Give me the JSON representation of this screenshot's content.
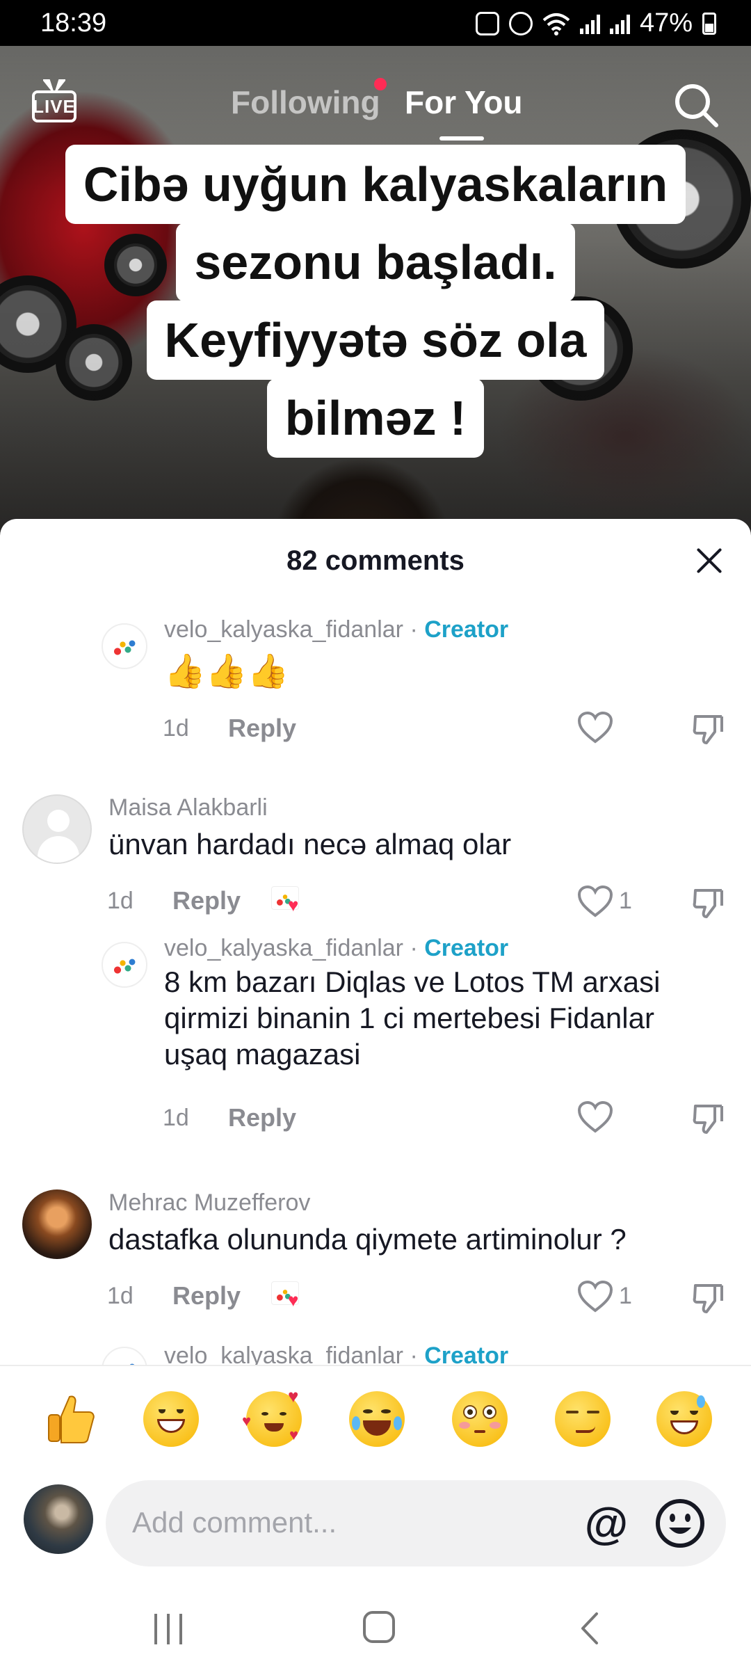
{
  "status_bar": {
    "time": "18:39",
    "battery": "47%",
    "icons": [
      "sync-icon",
      "alarm-icon",
      "wifi-icon",
      "signal-icon",
      "signal-icon",
      "battery-icon"
    ]
  },
  "top_nav": {
    "live_label": "LIVE",
    "tab_following": "Following",
    "tab_for_you": "For You",
    "active_tab": "For You"
  },
  "video": {
    "caption_lines": [
      "Cibə uyğun kalyaskaların",
      "sezonu başladı.",
      "Keyfiyyətə söz ola",
      "bilməz !"
    ]
  },
  "comments_sheet": {
    "title": "82 comments",
    "comments": [
      {
        "username": "velo_kalyaska_fidanlar",
        "separator": "·",
        "creator_label": "Creator",
        "text": "👍👍👍",
        "age": "1d",
        "reply_label": "Reply",
        "like_count": "",
        "is_creator": true
      },
      {
        "username": "Maisa Alakbarli",
        "text": "ünvan hardadı necə almaq olar",
        "age": "1d",
        "reply_label": "Reply",
        "like_count": "1",
        "liked_by_creator": true
      },
      {
        "username": "velo_kalyaska_fidanlar",
        "separator": "·",
        "creator_label": "Creator",
        "text": "8 km bazarı Diqlas ve Lotos TM arxasi qirmizi binanin 1 ci mertebesi Fidanlar uşaq magazasi",
        "age": "1d",
        "reply_label": "Reply",
        "like_count": "",
        "is_creator": true
      },
      {
        "username": "Mehrac Muzefferov",
        "text": "dastafka olununda qiymete artiminolur ?",
        "age": "1d",
        "reply_label": "Reply",
        "like_count": "1",
        "liked_by_creator": true
      },
      {
        "username": "velo_kalyaska_fidanlar",
        "separator": "·",
        "creator_label": "Creator",
        "is_creator": true
      }
    ]
  },
  "emoji_bar": [
    "👍",
    "😁",
    "🥰",
    "😂",
    "😳",
    "😏",
    "😅"
  ],
  "composer": {
    "placeholder": "Add comment...",
    "mention_label": "@"
  },
  "colors": {
    "accent_pink": "#fe2c55",
    "creator_blue": "#1da1c8",
    "text_primary": "#161823",
    "text_secondary": "#8a8b91"
  }
}
